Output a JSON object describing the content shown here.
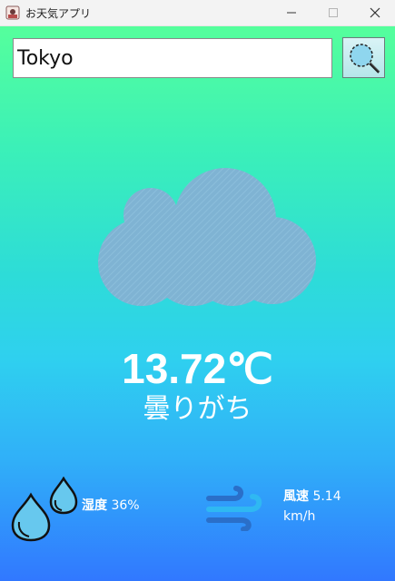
{
  "window": {
    "title": "お天気アプリ"
  },
  "search": {
    "value": "Tokyo"
  },
  "weather": {
    "icon": "cloud-icon",
    "temperature": "13.72℃",
    "condition": "曇りがち"
  },
  "humidity": {
    "label": "湿度",
    "value": "36%",
    "icon": "water-drops-icon"
  },
  "wind": {
    "label": "風速",
    "value": "5.14",
    "unit": "km/h",
    "icon": "wind-icon"
  },
  "colors": {
    "gradient_top": "#55ff9c",
    "gradient_mid": "#2ddcd8",
    "gradient_bottom": "#3178ff",
    "cloud": "#7fb3d3",
    "wind_icon": "#2a6fc9",
    "drop_fill": "#67c8ee"
  }
}
